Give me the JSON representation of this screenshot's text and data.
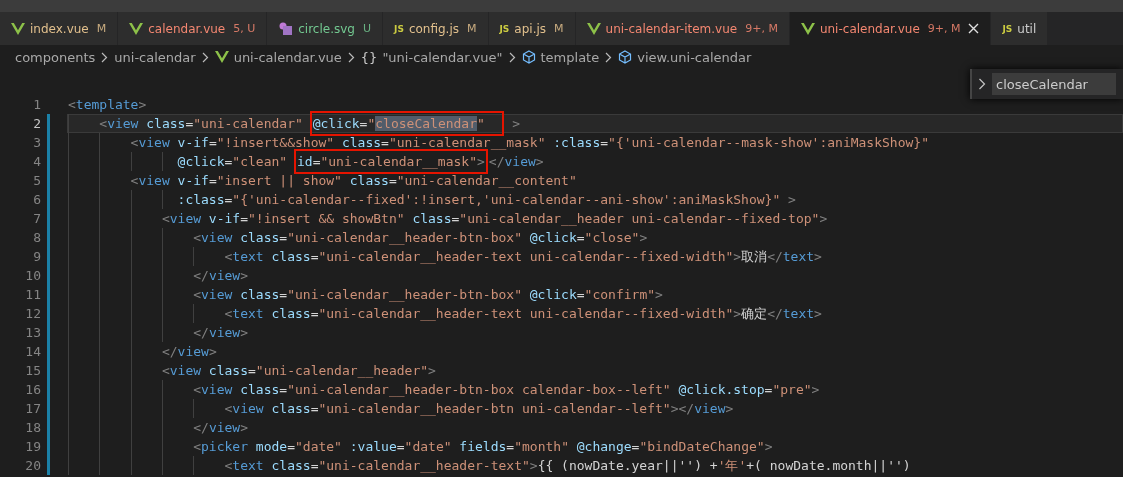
{
  "tabs": [
    {
      "kind": "vue",
      "label": "index.vue",
      "badge": "M",
      "color": "#e2c08d",
      "selected": false
    },
    {
      "kind": "vue",
      "label": "calendar.vue",
      "badge": "5, U",
      "color": "#f48771",
      "selected": false
    },
    {
      "kind": "svg",
      "label": "circle.svg",
      "badge": "U",
      "color": "#73c991",
      "selected": false
    },
    {
      "kind": "js",
      "icon_label": "JS",
      "label": "config.js",
      "badge": "M",
      "color": "#e2c08d",
      "selected": false
    },
    {
      "kind": "js",
      "icon_label": "JS",
      "label": "api.js",
      "badge": "M",
      "color": "#e2c08d",
      "selected": false
    },
    {
      "kind": "vue",
      "label": "uni-calendar-item.vue",
      "badge": "9+, M",
      "color": "#f48771",
      "selected": false
    },
    {
      "kind": "vue",
      "label": "uni-calendar.vue",
      "badge": "9+, M",
      "color": "#f48771",
      "selected": true
    },
    {
      "kind": "js",
      "icon_label": "JS",
      "label": "util",
      "color": "#cccccc",
      "selected": false
    }
  ],
  "breadcrumb": [
    {
      "kind": "plain",
      "label": "components"
    },
    {
      "kind": "plain",
      "label": "uni-calendar"
    },
    {
      "kind": "vue",
      "label": "uni-calendar.vue"
    },
    {
      "kind": "object",
      "icon_label": "{}",
      "label": "\"uni-calendar.vue\""
    },
    {
      "kind": "element",
      "label": "template"
    },
    {
      "kind": "element",
      "label": "view.uni-calendar"
    }
  ],
  "find": {
    "value": "closeCalendar"
  },
  "editor": {
    "lines": [
      {
        "number": "1",
        "current": false,
        "changed": false,
        "tokens": [
          {
            "kind": "p",
            "text": "<"
          },
          {
            "kind": "t",
            "text": "template"
          },
          {
            "kind": "p",
            "text": ">"
          }
        ]
      },
      {
        "number": "2",
        "current": true,
        "changed": true,
        "tokens": [
          {
            "kind": "p",
            "text": "    <"
          },
          {
            "kind": "t",
            "text": "view"
          },
          {
            "kind": "a",
            "text": " class"
          },
          {
            "kind": "o",
            "text": "="
          },
          {
            "kind": "s",
            "text": "\"uni-calendar\" "
          },
          {
            "kind": "box",
            "tokens": [
              {
                "kind": "a",
                "text": "@click"
              },
              {
                "kind": "o",
                "text": "="
              },
              {
                "kind": "s",
                "text": "\""
              },
              {
                "kind": "s",
                "text": "closeCalendar",
                "match": true
              },
              {
                "kind": "s",
                "text": "\"  "
              }
            ]
          },
          {
            "kind": "p",
            "text": " >"
          }
        ]
      },
      {
        "number": "3",
        "current": false,
        "changed": true,
        "tokens": [
          {
            "kind": "p",
            "text": "        <"
          },
          {
            "kind": "t",
            "text": "view"
          },
          {
            "kind": "a",
            "text": " v-if"
          },
          {
            "kind": "o",
            "text": "="
          },
          {
            "kind": "s",
            "text": "\"!insert&&show\""
          },
          {
            "kind": "a",
            "text": " class"
          },
          {
            "kind": "o",
            "text": "="
          },
          {
            "kind": "s",
            "text": "\"uni-calendar__mask\""
          },
          {
            "kind": "a",
            "text": " :class"
          },
          {
            "kind": "o",
            "text": "="
          },
          {
            "kind": "s",
            "text": "\"{'uni-calendar--mask-show':aniMaskShow}\""
          }
        ]
      },
      {
        "number": "4",
        "current": false,
        "changed": true,
        "tokens": [
          {
            "kind": "a",
            "text": "              @click"
          },
          {
            "kind": "o",
            "text": "="
          },
          {
            "kind": "s",
            "text": "\"clean\" "
          },
          {
            "kind": "box",
            "tokens": [
              {
                "kind": "a",
                "text": "id"
              },
              {
                "kind": "o",
                "text": "="
              },
              {
                "kind": "s",
                "text": "\"uni-calendar__mask\""
              },
              {
                "kind": "p",
                "text": ">"
              }
            ]
          },
          {
            "kind": "p",
            "text": "</"
          },
          {
            "kind": "t",
            "text": "view"
          },
          {
            "kind": "p",
            "text": ">"
          }
        ]
      },
      {
        "number": "5",
        "current": false,
        "changed": true,
        "tokens": [
          {
            "kind": "p",
            "text": "        <"
          },
          {
            "kind": "t",
            "text": "view"
          },
          {
            "kind": "a",
            "text": " v-if"
          },
          {
            "kind": "o",
            "text": "="
          },
          {
            "kind": "s",
            "text": "\"insert || show\""
          },
          {
            "kind": "a",
            "text": " class"
          },
          {
            "kind": "o",
            "text": "="
          },
          {
            "kind": "s",
            "text": "\"uni-calendar__content\""
          }
        ]
      },
      {
        "number": "6",
        "current": false,
        "changed": true,
        "tokens": [
          {
            "kind": "a",
            "text": "              :class"
          },
          {
            "kind": "o",
            "text": "="
          },
          {
            "kind": "s",
            "text": "\"{'uni-calendar--fixed':!insert,'uni-calendar--ani-show':aniMaskShow}\""
          },
          {
            "kind": "p",
            "text": " >"
          }
        ]
      },
      {
        "number": "7",
        "current": false,
        "changed": true,
        "tokens": [
          {
            "kind": "p",
            "text": "            <"
          },
          {
            "kind": "t",
            "text": "view"
          },
          {
            "kind": "a",
            "text": " v-if"
          },
          {
            "kind": "o",
            "text": "="
          },
          {
            "kind": "s",
            "text": "\"!insert && showBtn\""
          },
          {
            "kind": "a",
            "text": " class"
          },
          {
            "kind": "o",
            "text": "="
          },
          {
            "kind": "s",
            "text": "\"uni-calendar__header uni-calendar--fixed-top\""
          },
          {
            "kind": "p",
            "text": ">"
          }
        ]
      },
      {
        "number": "8",
        "current": false,
        "changed": true,
        "tokens": [
          {
            "kind": "p",
            "text": "                <"
          },
          {
            "kind": "t",
            "text": "view"
          },
          {
            "kind": "a",
            "text": " class"
          },
          {
            "kind": "o",
            "text": "="
          },
          {
            "kind": "s",
            "text": "\"uni-calendar__header-btn-box\""
          },
          {
            "kind": "a",
            "text": " @click"
          },
          {
            "kind": "o",
            "text": "="
          },
          {
            "kind": "s",
            "text": "\"close\""
          },
          {
            "kind": "p",
            "text": ">"
          }
        ]
      },
      {
        "number": "9",
        "current": false,
        "changed": true,
        "tokens": [
          {
            "kind": "p",
            "text": "                    <"
          },
          {
            "kind": "t",
            "text": "text"
          },
          {
            "kind": "a",
            "text": " class"
          },
          {
            "kind": "o",
            "text": "="
          },
          {
            "kind": "s",
            "text": "\"uni-calendar__header-text uni-calendar--fixed-width\""
          },
          {
            "kind": "p",
            "text": ">"
          },
          {
            "kind": "x",
            "text": "取消"
          },
          {
            "kind": "p",
            "text": "</"
          },
          {
            "kind": "t",
            "text": "text"
          },
          {
            "kind": "p",
            "text": ">"
          }
        ]
      },
      {
        "number": "10",
        "current": false,
        "changed": true,
        "tokens": [
          {
            "kind": "p",
            "text": "                </"
          },
          {
            "kind": "t",
            "text": "view"
          },
          {
            "kind": "p",
            "text": ">"
          }
        ]
      },
      {
        "number": "11",
        "current": false,
        "changed": true,
        "tokens": [
          {
            "kind": "p",
            "text": "                <"
          },
          {
            "kind": "t",
            "text": "view"
          },
          {
            "kind": "a",
            "text": " class"
          },
          {
            "kind": "o",
            "text": "="
          },
          {
            "kind": "s",
            "text": "\"uni-calendar__header-btn-box\""
          },
          {
            "kind": "a",
            "text": " @click"
          },
          {
            "kind": "o",
            "text": "="
          },
          {
            "kind": "s",
            "text": "\"confirm\""
          },
          {
            "kind": "p",
            "text": ">"
          }
        ]
      },
      {
        "number": "12",
        "current": false,
        "changed": true,
        "tokens": [
          {
            "kind": "p",
            "text": "                    <"
          },
          {
            "kind": "t",
            "text": "text"
          },
          {
            "kind": "a",
            "text": " class"
          },
          {
            "kind": "o",
            "text": "="
          },
          {
            "kind": "s",
            "text": "\"uni-calendar__header-text uni-calendar--fixed-width\""
          },
          {
            "kind": "p",
            "text": ">"
          },
          {
            "kind": "x",
            "text": "确定"
          },
          {
            "kind": "p",
            "text": "</"
          },
          {
            "kind": "t",
            "text": "text"
          },
          {
            "kind": "p",
            "text": ">"
          }
        ]
      },
      {
        "number": "13",
        "current": false,
        "changed": true,
        "tokens": [
          {
            "kind": "p",
            "text": "                </"
          },
          {
            "kind": "t",
            "text": "view"
          },
          {
            "kind": "p",
            "text": ">"
          }
        ]
      },
      {
        "number": "14",
        "current": false,
        "changed": true,
        "tokens": [
          {
            "kind": "p",
            "text": "            </"
          },
          {
            "kind": "t",
            "text": "view"
          },
          {
            "kind": "p",
            "text": ">"
          }
        ]
      },
      {
        "number": "15",
        "current": false,
        "changed": true,
        "tokens": [
          {
            "kind": "p",
            "text": "            <"
          },
          {
            "kind": "t",
            "text": "view"
          },
          {
            "kind": "a",
            "text": " class"
          },
          {
            "kind": "o",
            "text": "="
          },
          {
            "kind": "s",
            "text": "\"uni-calendar__header\""
          },
          {
            "kind": "p",
            "text": ">"
          }
        ]
      },
      {
        "number": "16",
        "current": false,
        "changed": true,
        "tokens": [
          {
            "kind": "p",
            "text": "                <"
          },
          {
            "kind": "t",
            "text": "view"
          },
          {
            "kind": "a",
            "text": " class"
          },
          {
            "kind": "o",
            "text": "="
          },
          {
            "kind": "s",
            "text": "\"uni-calendar__header-btn-box calendar-box--left\""
          },
          {
            "kind": "a",
            "text": " @click.stop"
          },
          {
            "kind": "o",
            "text": "="
          },
          {
            "kind": "s",
            "text": "\"pre\""
          },
          {
            "kind": "p",
            "text": ">"
          }
        ]
      },
      {
        "number": "17",
        "current": false,
        "changed": true,
        "tokens": [
          {
            "kind": "p",
            "text": "                    <"
          },
          {
            "kind": "t",
            "text": "view"
          },
          {
            "kind": "a",
            "text": " class"
          },
          {
            "kind": "o",
            "text": "="
          },
          {
            "kind": "s",
            "text": "\"uni-calendar__header-btn uni-calendar--left\""
          },
          {
            "kind": "p",
            "text": "></"
          },
          {
            "kind": "t",
            "text": "view"
          },
          {
            "kind": "p",
            "text": ">"
          }
        ]
      },
      {
        "number": "18",
        "current": false,
        "changed": true,
        "tokens": [
          {
            "kind": "p",
            "text": "                </"
          },
          {
            "kind": "t",
            "text": "view"
          },
          {
            "kind": "p",
            "text": ">"
          }
        ]
      },
      {
        "number": "19",
        "current": false,
        "changed": true,
        "tokens": [
          {
            "kind": "p",
            "text": "                <"
          },
          {
            "kind": "t",
            "text": "picker"
          },
          {
            "kind": "a",
            "text": " mode"
          },
          {
            "kind": "o",
            "text": "="
          },
          {
            "kind": "s",
            "text": "\"date\""
          },
          {
            "kind": "a",
            "text": " :value"
          },
          {
            "kind": "o",
            "text": "="
          },
          {
            "kind": "s",
            "text": "\"date\""
          },
          {
            "kind": "a",
            "text": " fields"
          },
          {
            "kind": "o",
            "text": "="
          },
          {
            "kind": "s",
            "text": "\"month\""
          },
          {
            "kind": "a",
            "text": " @change"
          },
          {
            "kind": "o",
            "text": "="
          },
          {
            "kind": "s",
            "text": "\"bindDateChange\""
          },
          {
            "kind": "p",
            "text": ">"
          }
        ]
      },
      {
        "number": "20",
        "current": false,
        "changed": true,
        "tokens": [
          {
            "kind": "p",
            "text": "                    <"
          },
          {
            "kind": "t",
            "text": "text"
          },
          {
            "kind": "a",
            "text": " class"
          },
          {
            "kind": "o",
            "text": "="
          },
          {
            "kind": "s",
            "text": "\"uni-calendar__header-text\""
          },
          {
            "kind": "p",
            "text": ">"
          },
          {
            "kind": "x",
            "text": "{{ (nowDate.year||'') +"
          },
          {
            "kind": "s",
            "text": "'年'"
          },
          {
            "kind": "x",
            "text": "+( nowDate.month||'')"
          }
        ]
      }
    ]
  }
}
